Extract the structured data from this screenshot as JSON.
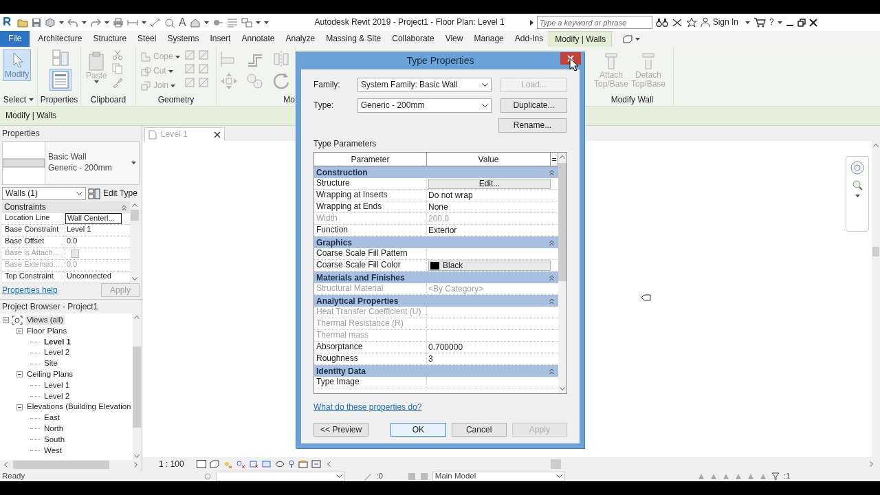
{
  "app_logo": "R",
  "quick_access_text_tool": "A",
  "title": "Autodesk Revit 2019 - Project1 - Floor Plan: Level 1",
  "search": {
    "placeholder": "Type a keyword or phrase"
  },
  "sign_in": "Sign In",
  "help": "?",
  "ribbon_tabs": [
    {
      "label": "File",
      "kind": "file",
      "selected": false
    },
    {
      "label": "Architecture",
      "kind": "tab",
      "selected": false
    },
    {
      "label": "Structure",
      "kind": "tab",
      "selected": false
    },
    {
      "label": "Steel",
      "kind": "tab",
      "selected": false
    },
    {
      "label": "Systems",
      "kind": "tab",
      "selected": false
    },
    {
      "label": "Insert",
      "kind": "tab",
      "selected": false
    },
    {
      "label": "Annotate",
      "kind": "tab",
      "selected": false
    },
    {
      "label": "Analyze",
      "kind": "tab",
      "selected": false
    },
    {
      "label": "Massing & Site",
      "kind": "tab",
      "selected": false
    },
    {
      "label": "Collaborate",
      "kind": "tab",
      "selected": false
    },
    {
      "label": "View",
      "kind": "tab",
      "selected": false
    },
    {
      "label": "Manage",
      "kind": "tab",
      "selected": false
    },
    {
      "label": "Add-Ins",
      "kind": "tab",
      "selected": false
    },
    {
      "label": "Modify | Walls",
      "kind": "context",
      "selected": true
    }
  ],
  "ribbon": {
    "select": {
      "tool": "Modify",
      "selected": true,
      "label": "Select"
    },
    "properties": {
      "selected": true,
      "label": "Properties"
    },
    "clipboard": {
      "paste": "Paste",
      "paste_disabled": true,
      "label": "Clipboard"
    },
    "geometry": {
      "tools": [
        {
          "label": "Cope",
          "disabled": true
        },
        {
          "label": "Cut",
          "disabled": true
        },
        {
          "label": "Join",
          "disabled": true
        }
      ],
      "label": "Geometry"
    },
    "modify": {
      "label": "Mo"
    },
    "modify_wall": {
      "tools": [
        {
          "label": "Attach Top/Base",
          "disabled": true
        },
        {
          "label": "Detach Top/Base",
          "disabled": true
        }
      ],
      "label": "Modify Wall"
    }
  },
  "context_bar": "Modify | Walls",
  "properties": {
    "title": "Properties",
    "type_name": "Basic Wall",
    "type_sub": "Generic - 200mm",
    "filter": "Walls (1)",
    "edit_type": "Edit Type",
    "group": "Constraints",
    "rows": [
      {
        "name": "Location Line",
        "value": "Wall Centerl...",
        "kind": "field",
        "disabled": false
      },
      {
        "name": "Base Constraint",
        "value": "Level 1",
        "kind": "text",
        "disabled": false
      },
      {
        "name": "Base Offset",
        "value": "0.0",
        "kind": "text",
        "disabled": false
      },
      {
        "name": "Base is Attach...",
        "kind": "checkbox",
        "checked": false,
        "disabled": true
      },
      {
        "name": "Base Extensio...",
        "value": "0.0",
        "kind": "text",
        "disabled": true
      },
      {
        "name": "Top Constraint",
        "value": "Unconnected",
        "kind": "text",
        "disabled": false
      }
    ],
    "help": "Properties help",
    "apply": "Apply",
    "apply_disabled": true
  },
  "project_browser": {
    "title": "Project Browser - Project1",
    "tree": [
      {
        "label": "Views (all)",
        "expanded": true,
        "selected": true,
        "current": false,
        "children": [
          {
            "label": "Floor Plans",
            "expanded": true,
            "selected": false,
            "current": false,
            "children": [
              {
                "label": "Level 1",
                "selected": false,
                "current": true
              },
              {
                "label": "Level 2",
                "selected": false,
                "current": false
              },
              {
                "label": "Site",
                "selected": false,
                "current": false
              }
            ]
          },
          {
            "label": "Ceiling Plans",
            "expanded": true,
            "selected": false,
            "current": false,
            "children": [
              {
                "label": "Level 1",
                "selected": false,
                "current": false
              },
              {
                "label": "Level 2",
                "selected": false,
                "current": false
              }
            ]
          },
          {
            "label": "Elevations (Building Elevation",
            "expanded": true,
            "selected": false,
            "current": false,
            "children": [
              {
                "label": "East",
                "selected": false,
                "current": false
              },
              {
                "label": "North",
                "selected": false,
                "current": false
              },
              {
                "label": "South",
                "selected": false,
                "current": false
              },
              {
                "label": "West",
                "selected": false,
                "current": false
              }
            ]
          }
        ]
      }
    ]
  },
  "view": {
    "tab": "Level 1",
    "scale": "1 : 100"
  },
  "status_bar": {
    "text": "Ready",
    "selection_count": ":0",
    "model": "Main Model",
    "filter_count": ":1"
  },
  "dialog": {
    "title": "Type Properties",
    "family_label": "Family:",
    "family": "System Family: Basic Wall",
    "type_label": "Type:",
    "type": "Generic - 200mm",
    "load": "Load...",
    "load_disabled": true,
    "duplicate": "Duplicate...",
    "rename": "Rename...",
    "section": "Type Parameters",
    "columns": [
      "Parameter",
      "Value",
      "="
    ],
    "groups": [
      {
        "label": "Construction",
        "rows": [
          {
            "name": "Structure",
            "value": "Edit...",
            "kind": "button",
            "disabled": false
          },
          {
            "name": "Wrapping at Inserts",
            "value": "Do not wrap",
            "kind": "text",
            "disabled": false
          },
          {
            "name": "Wrapping at Ends",
            "value": "None",
            "kind": "text",
            "disabled": false
          },
          {
            "name": "Width",
            "value": "200.0",
            "kind": "text",
            "disabled": true
          },
          {
            "name": "Function",
            "value": "Exterior",
            "kind": "text",
            "disabled": false
          }
        ]
      },
      {
        "label": "Graphics",
        "rows": [
          {
            "name": "Coarse Scale Fill Pattern",
            "kind": "text",
            "disabled": false
          },
          {
            "name": "Coarse Scale Fill Color",
            "value": "Black",
            "kind": "color",
            "color": "#000000",
            "disabled": false
          }
        ]
      },
      {
        "label": "Materials and Finishes",
        "rows": [
          {
            "name": "Structural Material",
            "value": "<By Category>",
            "kind": "text",
            "disabled": true
          }
        ]
      },
      {
        "label": "Analytical Properties",
        "rows": [
          {
            "name": "Heat Transfer Coefficient (U)",
            "kind": "text",
            "disabled": true
          },
          {
            "name": "Thermal Resistance (R)",
            "kind": "text",
            "disabled": true
          },
          {
            "name": "Thermal mass",
            "kind": "text",
            "disabled": true
          },
          {
            "name": "Absorptance",
            "value": "0.700000",
            "kind": "text",
            "disabled": false
          },
          {
            "name": "Roughness",
            "value": "3",
            "kind": "text",
            "disabled": false
          }
        ]
      },
      {
        "label": "Identity Data",
        "rows": [
          {
            "name": "Type Image",
            "kind": "text",
            "disabled": false
          }
        ]
      }
    ],
    "help_link": "What do these properties do?",
    "buttons": [
      {
        "label": "<< Preview",
        "kind": "normal",
        "disabled": false
      },
      {
        "label": "OK",
        "kind": "default",
        "disabled": false
      },
      {
        "label": "Cancel",
        "kind": "normal",
        "disabled": false
      },
      {
        "label": "Apply",
        "kind": "normal",
        "disabled": true
      }
    ]
  }
}
